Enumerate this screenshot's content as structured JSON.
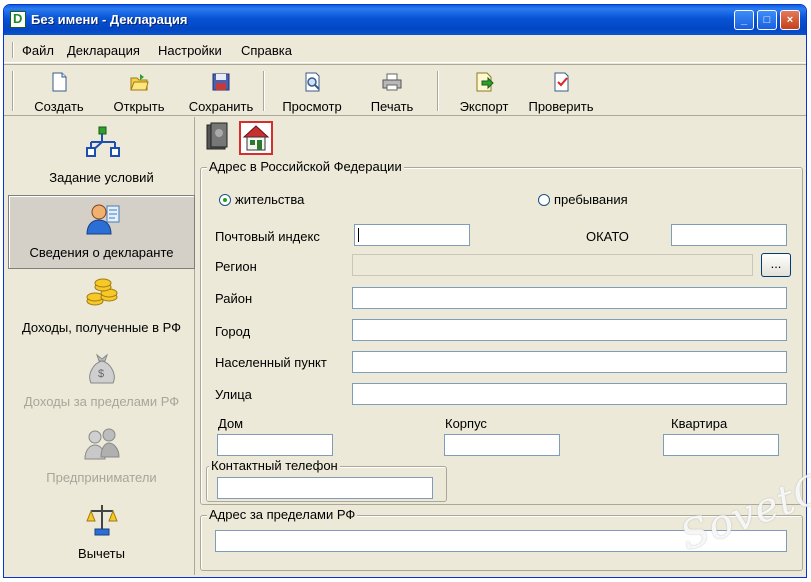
{
  "window": {
    "title": "Без имени - Декларация"
  },
  "menu": [
    "Файл",
    "Декларация",
    "Настройки",
    "Справка"
  ],
  "toolbar": {
    "create": "Создать",
    "open": "Открыть",
    "save": "Сохранить",
    "preview": "Просмотр",
    "print": "Печать",
    "export": "Экспорт",
    "check": "Проверить"
  },
  "sidebar": [
    {
      "label": "Задание условий",
      "state": "normal"
    },
    {
      "label": "Сведения о декларанте",
      "state": "active"
    },
    {
      "label": "Доходы, полученные в РФ",
      "state": "normal"
    },
    {
      "label": "Доходы за пределами РФ",
      "state": "disabled"
    },
    {
      "label": "Предприниматели",
      "state": "disabled"
    },
    {
      "label": "Вычеты",
      "state": "normal"
    }
  ],
  "address_rf": {
    "legend": "Адрес в Российской Федерации",
    "radio_residence": "жительства",
    "radio_stay": "пребывания",
    "selected": "жительства",
    "postal_index_label": "Почтовый индекс",
    "okato_label": "ОКАТО",
    "region_label": "Регион",
    "region_button": "...",
    "district_label": "Район",
    "city_label": "Город",
    "locality_label": "Населенный пункт",
    "street_label": "Улица",
    "house_label": "Дом",
    "building_label": "Корпус",
    "apartment_label": "Квартира"
  },
  "phone": {
    "legend": "Контактный телефон"
  },
  "address_abroad": {
    "legend": "Адрес за пределами РФ"
  },
  "watermark": "SovetClub",
  "colors": {
    "title_bar": "#0753d4",
    "window_bg": "#ece9d8",
    "selected_tab_border": "#d62d2d"
  }
}
